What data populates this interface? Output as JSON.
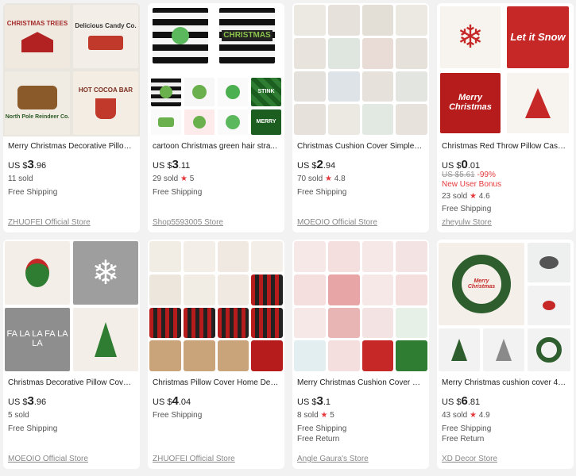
{
  "products": [
    {
      "title": "Merry Christmas Decorative Pillow...",
      "currency": "US $",
      "price_int": "3",
      "price_dec": ".96",
      "sold": "11 sold",
      "rating": "",
      "shipping": "Free Shipping",
      "store": "ZHUOFEI Official Store",
      "tile_text": [
        "CHRISTMAS TREES",
        "Delicious Candy Co.",
        "North Pole Reindeer Co.",
        "HOT COCOA BAR"
      ]
    },
    {
      "title": "cartoon Christmas green hair stra...",
      "currency": "US $",
      "price_int": "3",
      "price_dec": ".11",
      "sold": "29 sold",
      "rating": "5",
      "shipping": "Free Shipping",
      "store": "Shop5593005 Store",
      "tile_text": [
        "",
        "CHRISTMAS",
        "STINK",
        "MERRY"
      ]
    },
    {
      "title": "Christmas Cushion Cover Simple P...",
      "currency": "US $",
      "price_int": "2",
      "price_dec": ".94",
      "sold": "70 sold",
      "rating": "4.8",
      "shipping": "Free Shipping",
      "store": "MOEOIO Official Store"
    },
    {
      "title": "Christmas Red Throw Pillow Case ...",
      "currency": "US $",
      "price_int": "0",
      "price_dec": ".01",
      "original_price": "US $5.61",
      "discount": "-99%",
      "bonus": "New User Bonus",
      "sold": "23 sold",
      "rating": "4.6",
      "shipping": "Free Shipping",
      "store": "zheyulw Store",
      "tile_text": [
        "",
        "Let it Snow",
        "Merry Christmas",
        ""
      ]
    },
    {
      "title": "Christmas Decorative Pillow Cover ...",
      "currency": "US $",
      "price_int": "3",
      "price_dec": ".96",
      "sold": "5 sold",
      "rating": "",
      "shipping": "Free Shipping",
      "store": "MOEOIO Official Store",
      "tile_text": [
        "",
        "",
        "FA LA LA FA LA LA",
        ""
      ]
    },
    {
      "title": "Christmas Pillow Cover Home Dec...",
      "currency": "US $",
      "price_int": "4",
      "price_dec": ".04",
      "sold": "",
      "rating": "",
      "shipping": "Free Shipping",
      "store": "ZHUOFEI Official Store"
    },
    {
      "title": "Merry Christmas Cushion Cover Sa...",
      "currency": "US $",
      "price_int": "3",
      "price_dec": ".1",
      "sold": "8 sold",
      "rating": "5",
      "shipping": "Free Shipping",
      "returns": "Free Return",
      "store": "Angle Gaura's Store"
    },
    {
      "title": "Merry Christmas cushion cover 45...",
      "currency": "US $",
      "price_int": "6",
      "price_dec": ".81",
      "sold": "43 sold",
      "rating": "4.9",
      "shipping": "Free Shipping",
      "returns": "Free Return",
      "store": "XD Decor Store",
      "tile_text": [
        "Merry Christmas"
      ]
    }
  ],
  "icons": {
    "rating": "star-icon"
  },
  "colors": {
    "accent_red": "#e4393c",
    "background": "#f2f2f2"
  }
}
